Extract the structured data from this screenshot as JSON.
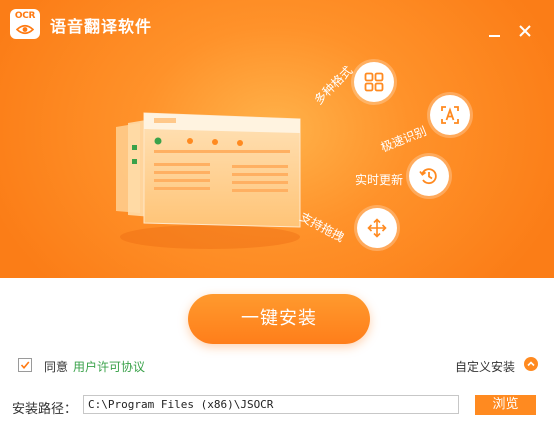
{
  "app": {
    "logo_text": "OCR",
    "title": "语音翻译软件"
  },
  "window_controls": {
    "minimize": "minimize-icon",
    "close": "close-icon"
  },
  "features": [
    {
      "label": "多种格式",
      "icon": "grid-icon"
    },
    {
      "label": "极速识别",
      "icon": "text-scan-icon"
    },
    {
      "label": "实时更新",
      "icon": "clock-refresh-icon"
    },
    {
      "label": "支持拖拽",
      "icon": "move-arrows-icon"
    }
  ],
  "install": {
    "button_label": "一键安装"
  },
  "agreement": {
    "checked": true,
    "prefix": "同意",
    "link": "用户许可协议"
  },
  "custom_install": {
    "label": "自定义安装",
    "icon": "chevron-up-icon"
  },
  "path": {
    "label": "安装路径：",
    "value": "C:\\Program Files (x86)\\JSOCR",
    "browse_label": "浏览"
  },
  "colors": {
    "accent": "#ff8a20",
    "link": "#3aa24a",
    "banner": "#fb7d17"
  }
}
